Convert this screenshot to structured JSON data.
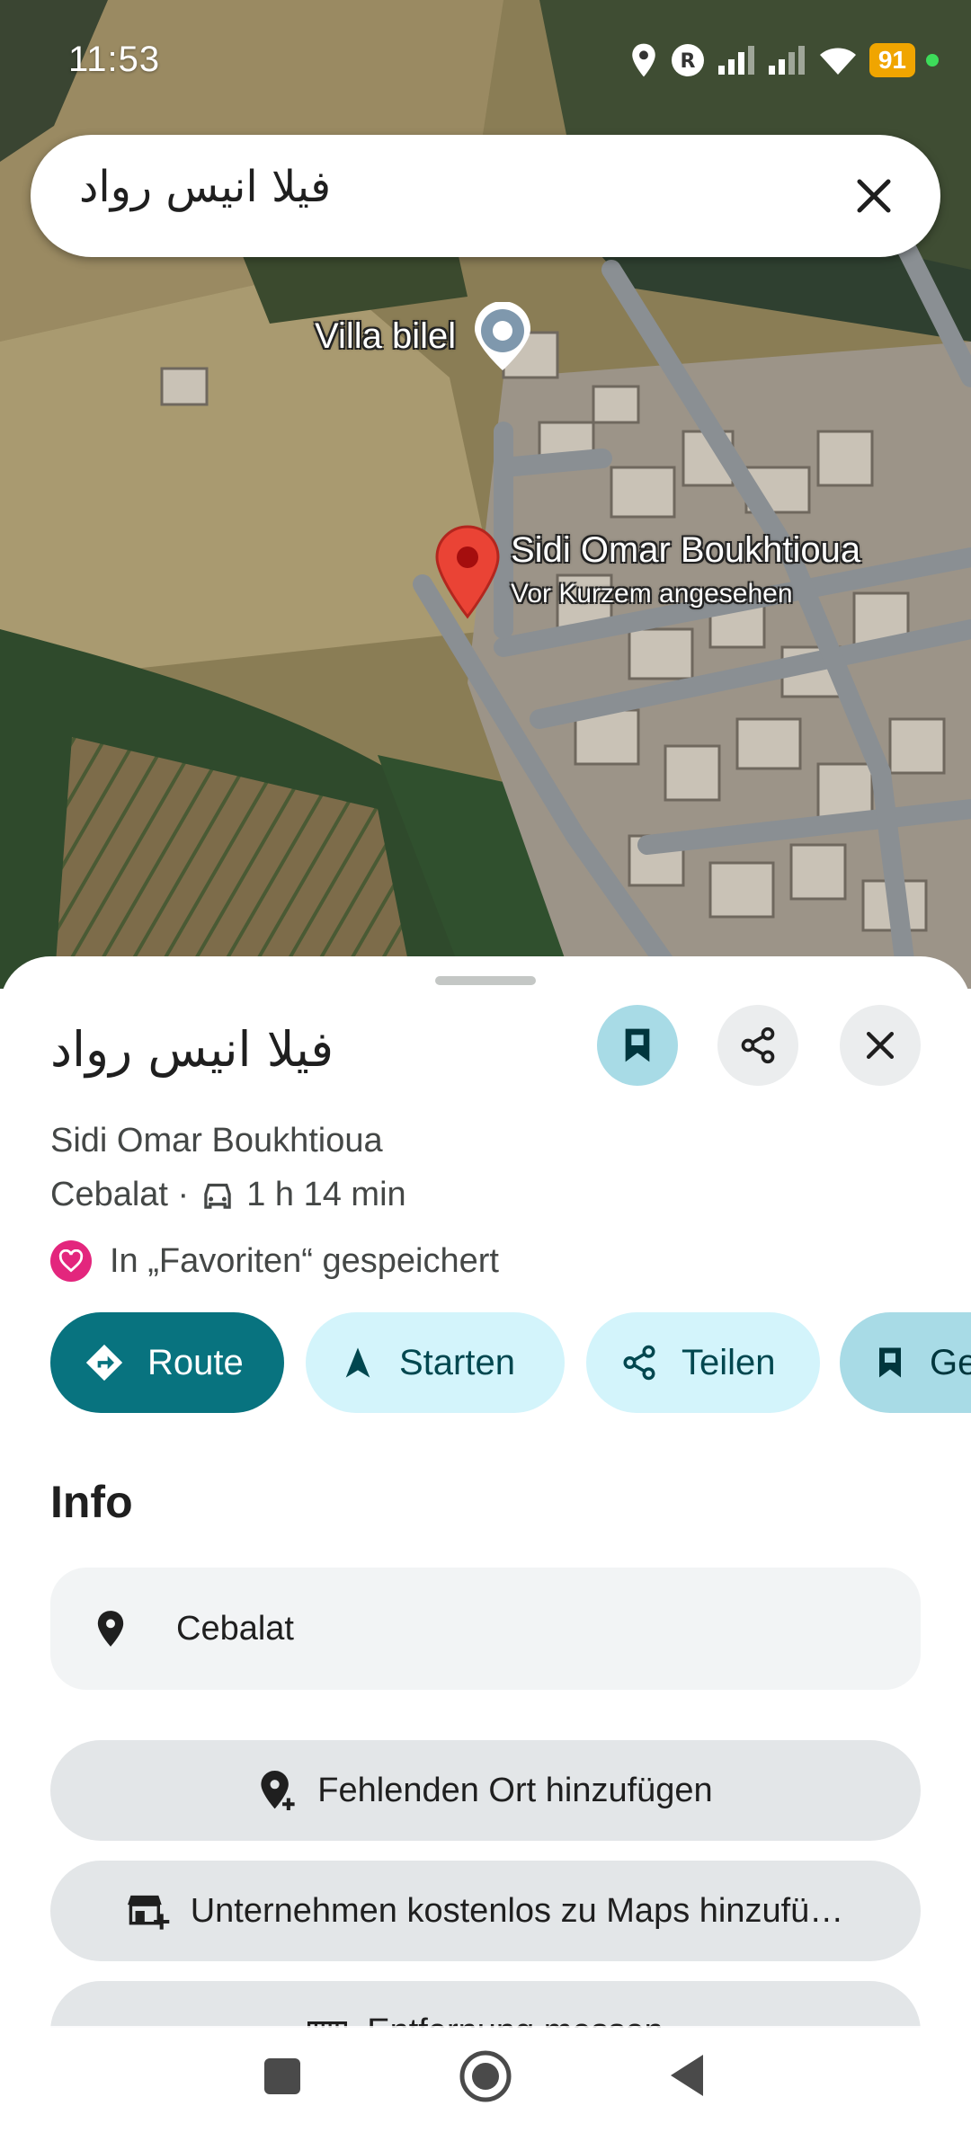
{
  "status_bar": {
    "time": "11:53",
    "battery": "91",
    "icons": [
      "location-icon",
      "r-badge-icon",
      "signal-icon",
      "signal-icon",
      "wifi-icon"
    ]
  },
  "search": {
    "query": "فيلا انيس رواد",
    "clear_icon": "close-icon"
  },
  "map": {
    "labels": {
      "villa": "Villa bilel",
      "place": "Sidi Omar Boukhtioua",
      "place_sub": "Vor Kurzem angesehen"
    },
    "pin_color": "#ea4335"
  },
  "sheet": {
    "title": "فيلا انيس رواد",
    "address": "Sidi Omar Boukhtioua",
    "city": "Cebalat ·",
    "drive_time": "1 h 14 min",
    "favorite_text": "In „Favoriten“ gespeichert",
    "actions": {
      "route": "Route",
      "start": "Starten",
      "share": "Teilen",
      "saved": "Ge"
    },
    "info_heading": "Info",
    "info_location": "Cebalat",
    "add_missing_place": "Fehlenden Ort hinzufügen",
    "add_business": "Unternehmen kostenlos zu Maps hinzufü…",
    "measure_distance": "Entfernung messen"
  },
  "colors": {
    "accent_teal": "#08737f",
    "chip_light": "#d3f4fb",
    "save_bg": "#a8dbe6",
    "favorite_pink": "#e3267d"
  }
}
